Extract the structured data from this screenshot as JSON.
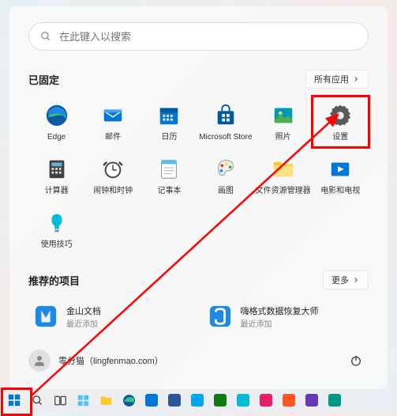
{
  "search": {
    "placeholder": "在此键入以搜索"
  },
  "pinned": {
    "title": "已固定",
    "all_apps_label": "所有应用",
    "apps": [
      {
        "name": "edge",
        "label": "Edge"
      },
      {
        "name": "mail",
        "label": "邮件"
      },
      {
        "name": "calendar",
        "label": "日历"
      },
      {
        "name": "microsoft-store",
        "label": "Microsoft Store"
      },
      {
        "name": "photos",
        "label": "照片"
      },
      {
        "name": "settings",
        "label": "设置"
      },
      {
        "name": "calculator",
        "label": "计算器"
      },
      {
        "name": "alarms-clock",
        "label": "闹钟和时钟"
      },
      {
        "name": "notepad",
        "label": "记事本"
      },
      {
        "name": "paint",
        "label": "画图"
      },
      {
        "name": "file-explorer",
        "label": "文件资源管理器"
      },
      {
        "name": "movies-tv",
        "label": "电影和电视"
      },
      {
        "name": "tips",
        "label": "使用技巧"
      }
    ]
  },
  "recommended": {
    "title": "推荐的项目",
    "more_label": "更多",
    "items": [
      {
        "name": "jinshan-docs",
        "title": "金山文档",
        "subtitle": "最近添加"
      },
      {
        "name": "data-recovery",
        "title": "嗨格式数据恢复大师",
        "subtitle": "最近添加"
      }
    ]
  },
  "user": {
    "display_name": "零分猫（lingfenmao.com）"
  },
  "taskbar": {
    "items": [
      {
        "name": "start"
      },
      {
        "name": "search"
      },
      {
        "name": "task-view"
      },
      {
        "name": "widgets"
      },
      {
        "name": "file-explorer"
      },
      {
        "name": "edge"
      },
      {
        "name": "app1"
      },
      {
        "name": "app2"
      },
      {
        "name": "app3"
      },
      {
        "name": "app4"
      },
      {
        "name": "app5"
      },
      {
        "name": "app6"
      },
      {
        "name": "app7"
      },
      {
        "name": "app8"
      },
      {
        "name": "app9"
      }
    ]
  },
  "colors": {
    "highlight": "#ff0000",
    "edge": "#0078d4",
    "mail": "#0078d4",
    "calendar": "#0078d4",
    "store": "#005a9e",
    "photos": "#0099bc",
    "settings": "#5a5a5a",
    "tips": "#0099bc",
    "moviestv": "#0078d4",
    "rec1": "#1e88e5",
    "rec2": "#1e88e5"
  }
}
